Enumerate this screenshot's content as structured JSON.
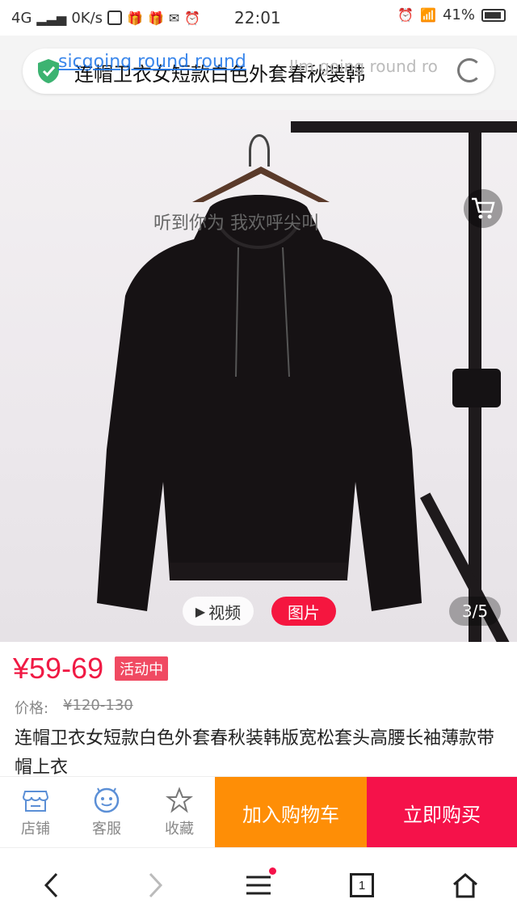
{
  "status_bar": {
    "network": "4G",
    "speed": "0K/s",
    "time": "22:01",
    "battery": "41%",
    "icons": [
      "signal-icon",
      "s-app-icon",
      "gift-icon",
      "gift-icon",
      "mail-icon",
      "alarm-icon",
      "alarm-icon",
      "wifi-icon",
      "battery-icon"
    ]
  },
  "url_bar": {
    "title": "连帽卫衣女短款白色外套春秋装韩",
    "overlay_link": "sicgoing round round",
    "overlay_faded": "I'm going round ro",
    "icons": [
      "shield-check-icon",
      "reload-icon"
    ]
  },
  "gallery": {
    "caption": "听到你为 我欢呼尖叫",
    "video_label": "视频",
    "photo_label": "图片",
    "page_indicator": "3/5",
    "icons": [
      "cart-icon",
      "play-icon"
    ]
  },
  "product": {
    "price": "¥59-69",
    "promo_badge": "活动中",
    "original_label": "价格:",
    "original_price": "¥120-130",
    "title": "连帽卫衣女短款白色外套春秋装韩版宽松套头高腰长袖薄款带帽上衣"
  },
  "action_bar": {
    "store_label": "店铺",
    "service_label": "客服",
    "favorite_label": "收藏",
    "add_to_cart": "加入购物车",
    "buy_now": "立即购买",
    "colors": {
      "cart_button": "#fe8e06",
      "buy_button": "#f5124a"
    }
  },
  "bottom_nav": {
    "tab_count": "1",
    "icons": [
      "back-icon",
      "forward-icon",
      "menu-icon",
      "tabs-icon",
      "home-icon"
    ]
  },
  "colors": {
    "accent": "#f01a44",
    "link": "#1a73e8"
  }
}
